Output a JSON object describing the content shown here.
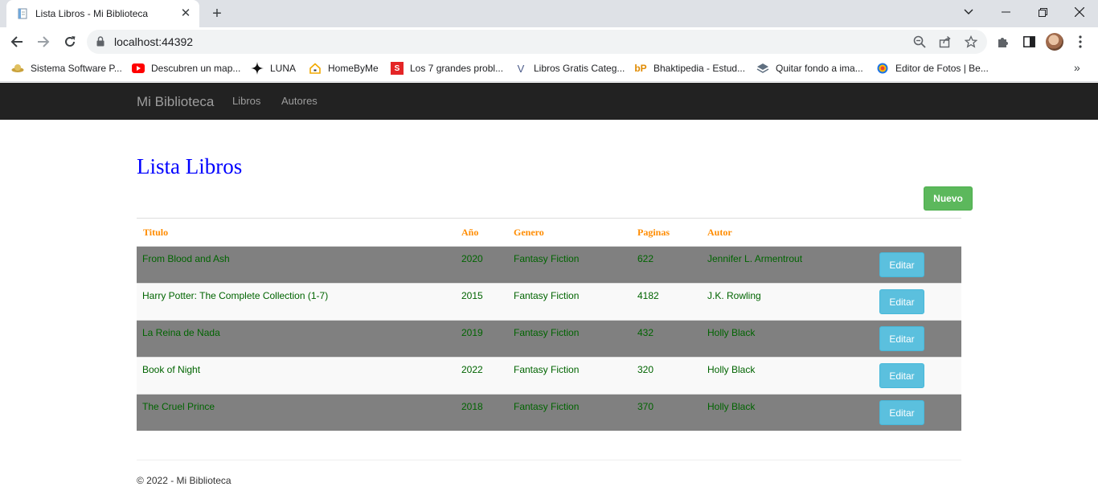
{
  "browser": {
    "tab_title": "Lista Libros - Mi Biblioteca",
    "url": "localhost:44392",
    "bookmarks": [
      {
        "label": "Sistema Software P...",
        "icon": "sombrero-icon"
      },
      {
        "label": "Descubren un map...",
        "icon": "youtube-icon"
      },
      {
        "label": "LUNA",
        "icon": "sparkle-icon"
      },
      {
        "label": "HomeByMe",
        "icon": "home-icon"
      },
      {
        "label": "Los 7 grandes probl...",
        "icon": "scribd-icon"
      },
      {
        "label": "Libros Gratis Categ...",
        "icon": "v-icon"
      },
      {
        "label": "Bhaktipedia - Estud...",
        "icon": "bhaktipedia-icon"
      },
      {
        "label": "Quitar fondo a ima...",
        "icon": "layers-icon"
      },
      {
        "label": "Editor de Fotos | Be...",
        "icon": "befunky-icon"
      }
    ],
    "bookmarks_more": "»"
  },
  "site": {
    "brand": "Mi Biblioteca",
    "nav": [
      "Libros",
      "Autores"
    ]
  },
  "page": {
    "title": "Lista Libros",
    "new_button": "Nuevo",
    "columns": [
      "Titulo",
      "Año",
      "Genero",
      "Paginas",
      "Autor"
    ],
    "rows": [
      {
        "titulo": "From Blood and Ash",
        "anio": "2020",
        "genero": "Fantasy Fiction",
        "paginas": "622",
        "autor": "Jennifer L. Armentrout",
        "action": "Editar"
      },
      {
        "titulo": "Harry Potter: The Complete Collection (1-7)",
        "anio": "2015",
        "genero": "Fantasy Fiction",
        "paginas": "4182",
        "autor": "J.K. Rowling",
        "action": "Editar"
      },
      {
        "titulo": "La Reina de Nada",
        "anio": "2019",
        "genero": "Fantasy Fiction",
        "paginas": "432",
        "autor": "Holly Black",
        "action": "Editar"
      },
      {
        "titulo": "Book of Night",
        "anio": "2022",
        "genero": "Fantasy Fiction",
        "paginas": "320",
        "autor": "Holly Black",
        "action": "Editar"
      },
      {
        "titulo": "The Cruel Prince",
        "anio": "2018",
        "genero": "Fantasy Fiction",
        "paginas": "370",
        "autor": "Holly Black",
        "action": "Editar"
      }
    ],
    "footer": "© 2022 - Mi Biblioteca"
  },
  "colors": {
    "title": "#0000ff",
    "header_text": "#ff8c00",
    "cell_text": "#006400",
    "row_striped": "#808080",
    "new_button": "#5cb85c",
    "edit_button": "#5bc0de",
    "navbar": "#222222"
  }
}
